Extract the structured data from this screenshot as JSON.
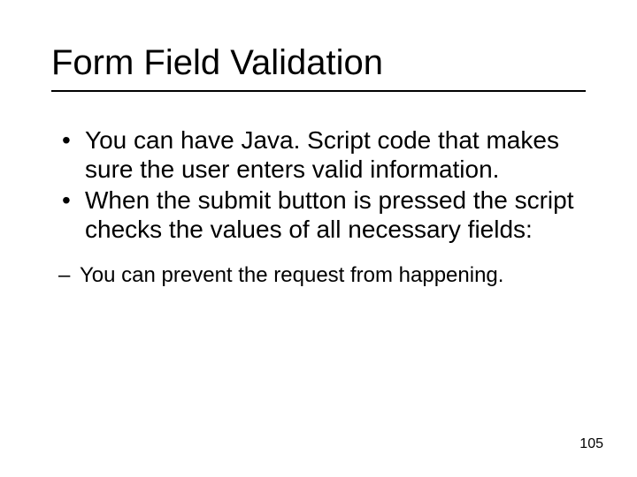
{
  "title": "Form Field Validation",
  "bullets": [
    "You can have Java. Script code that makes sure the user enters valid information.",
    "When the submit button is pressed the script checks the values of all necessary fields:"
  ],
  "sub_bullets": [
    "You can prevent the request from happening."
  ],
  "page_number": "105"
}
